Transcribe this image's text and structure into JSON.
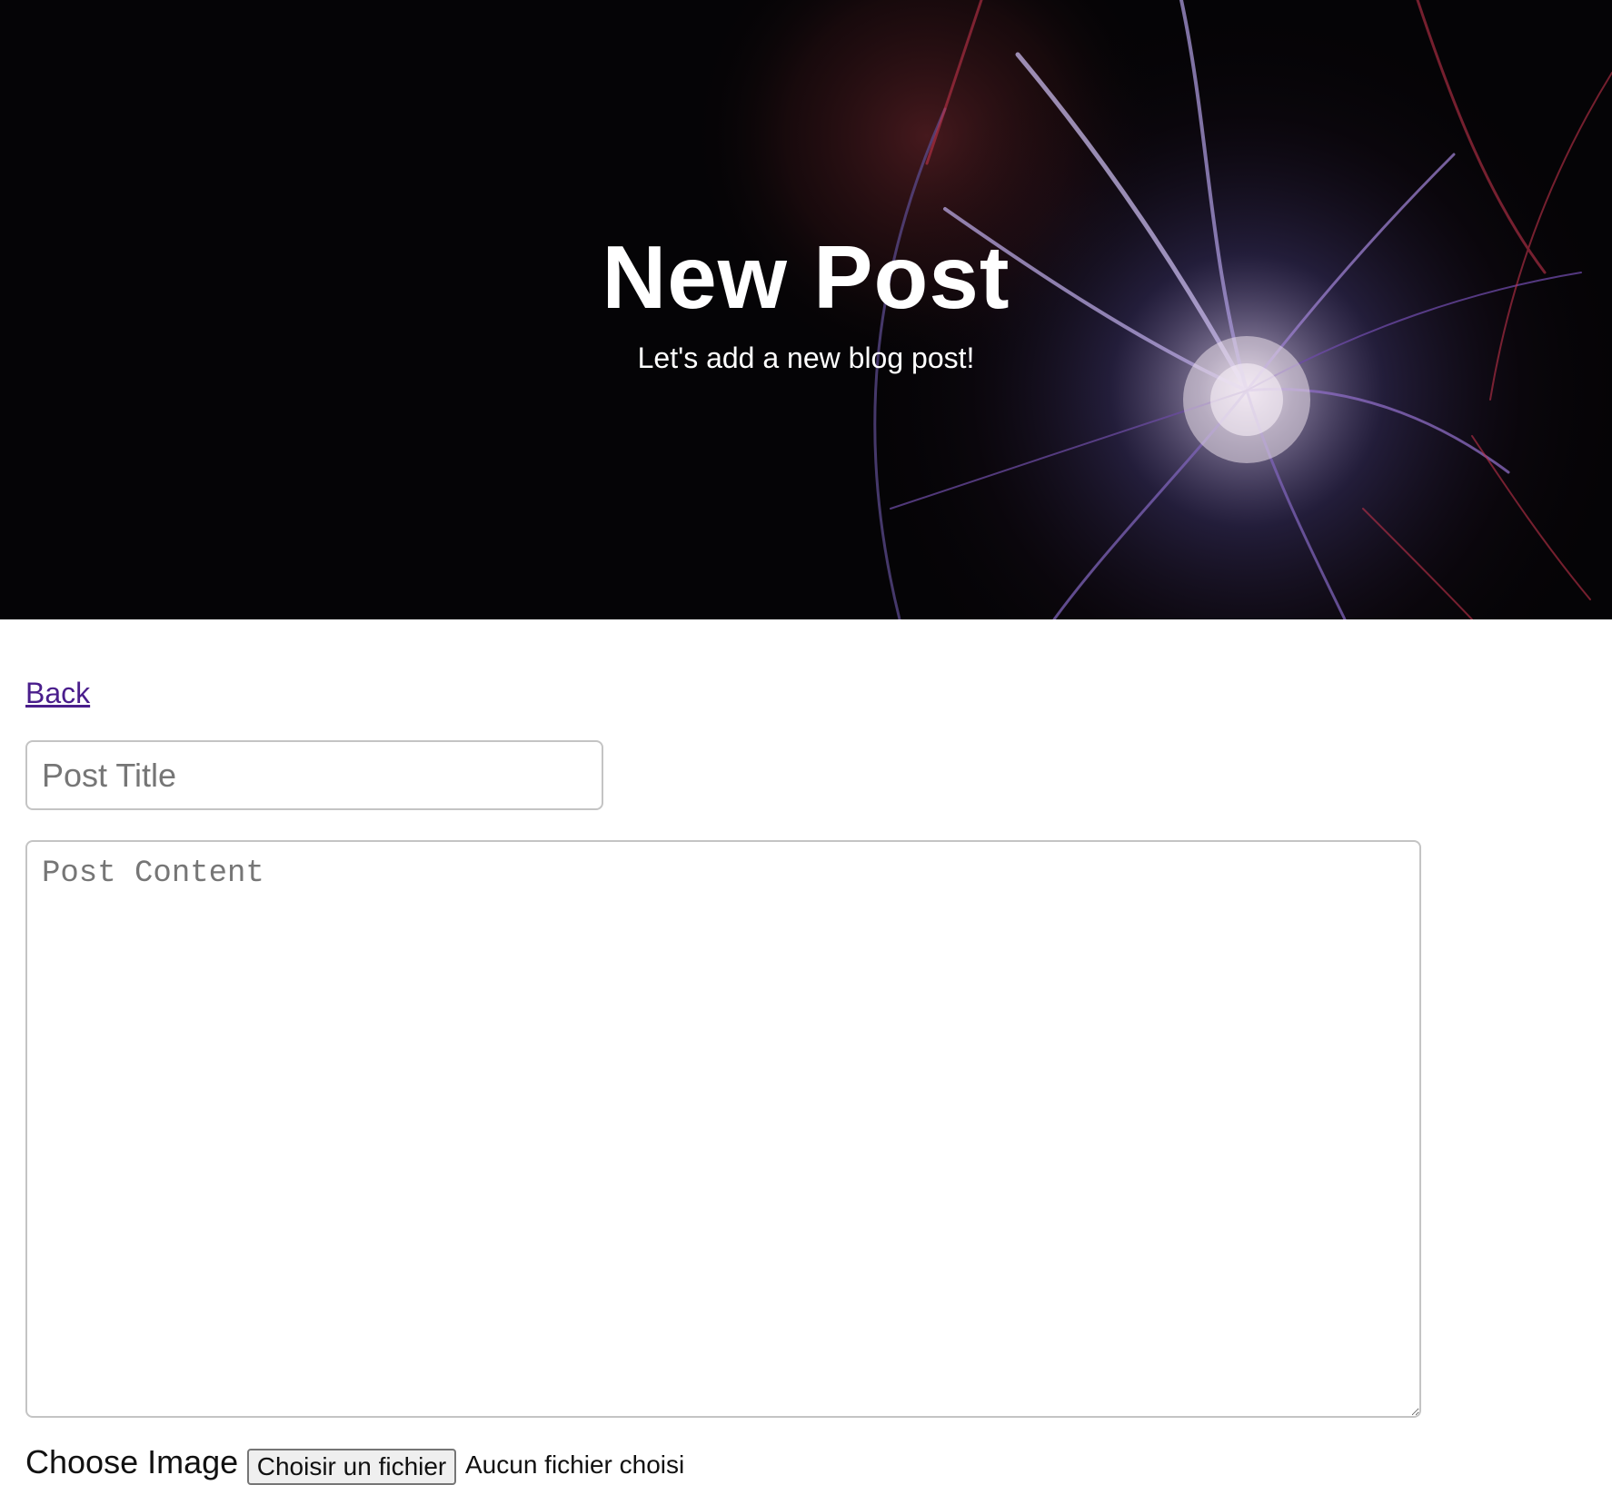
{
  "header": {
    "title": "New Post",
    "subtitle": "Let's add a new blog post!"
  },
  "nav": {
    "back_label": "Back"
  },
  "form": {
    "title_field": {
      "placeholder": "Post Title",
      "value": ""
    },
    "content_field": {
      "placeholder": "Post Content",
      "value": ""
    },
    "image_picker": {
      "label": "Choose Image",
      "button_label": "Choisir un fichier",
      "status": "Aucun fichier choisi"
    }
  },
  "colors": {
    "hero_background": "#050406",
    "link": "#4a1e8c",
    "input_border": "#c4c4c4",
    "placeholder": "#767676"
  }
}
